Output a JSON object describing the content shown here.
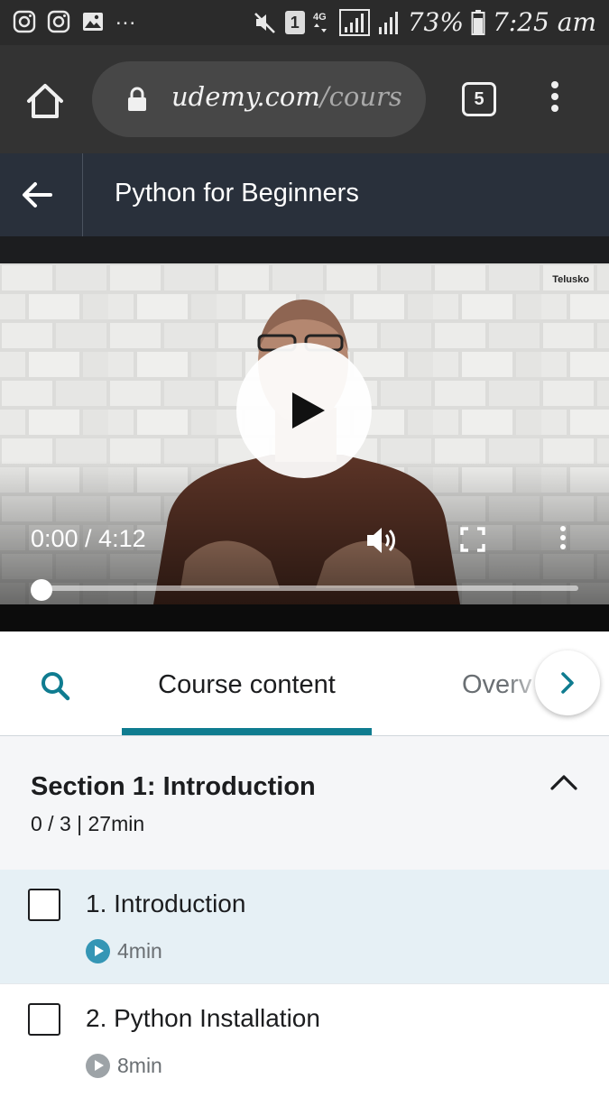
{
  "status_bar": {
    "battery_percent": "73%",
    "time": "7:25 am",
    "notifications_more": "...",
    "sim_slot": "1",
    "network_type": "4G",
    "icons": [
      "instagram-icon",
      "instagram-icon",
      "gallery-icon",
      "mute-icon",
      "sim-1-icon",
      "network-4g-icon",
      "signal-icon",
      "signal-icon",
      "battery-icon"
    ]
  },
  "browser": {
    "url_host": "udemy.com",
    "url_path": "/cours",
    "tab_count": "5",
    "icons": [
      "home-icon",
      "lock-icon",
      "menu-dots-icon"
    ]
  },
  "header": {
    "title": "Python for Beginners",
    "icons": [
      "back-arrow-icon"
    ]
  },
  "player": {
    "watermark": "Telusko",
    "time_readout": "0:00 / 4:12",
    "progress_fraction": 0,
    "icons": [
      "play-icon",
      "volume-icon",
      "fullscreen-icon",
      "more-vertical-icon"
    ]
  },
  "tabs": {
    "items": [
      {
        "label": "Course content",
        "active": true
      },
      {
        "label": "Overv",
        "active": false
      }
    ],
    "icons": [
      "search-icon",
      "chevron-right-icon"
    ]
  },
  "section": {
    "title": "Section 1: Introduction",
    "meta": "0 / 3 | 27min",
    "expanded": true,
    "lectures": [
      {
        "title": "1. Introduction",
        "duration": "4min",
        "active": true,
        "completed": false
      },
      {
        "title": "2. Python Installation",
        "duration": "8min",
        "active": false,
        "completed": false
      }
    ]
  },
  "colors": {
    "accent_teal": "#0f7c90",
    "header_bg": "#29303b",
    "active_row_bg": "#e6f0f5",
    "active_play_icon": "#3596b5",
    "inactive_play_icon": "#9da3a7"
  }
}
